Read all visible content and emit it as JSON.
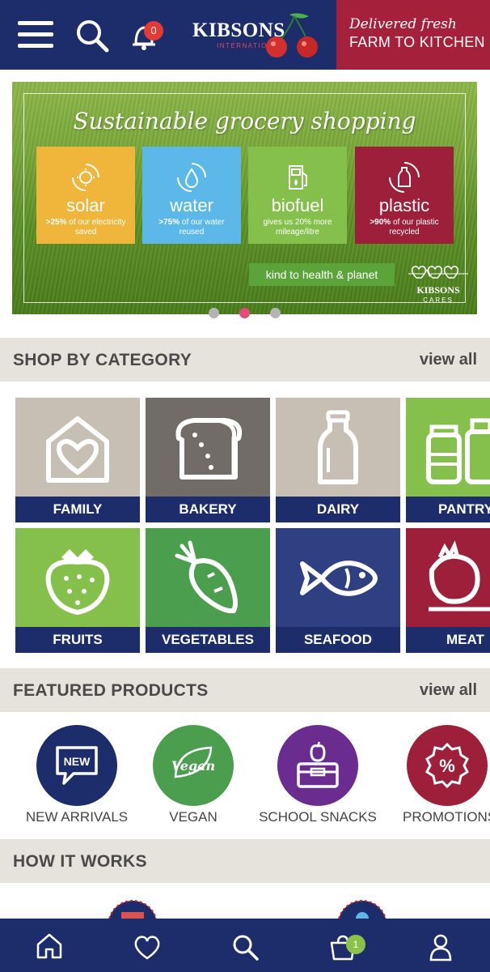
{
  "header": {
    "notification_count": "0",
    "brand_name": "KIBSONS",
    "brand_sub": "INTERNATIONAL",
    "tagline_line1": "Delivered fresh",
    "tagline_line2": "FARM TO KITCHEN",
    "colors": {
      "navy": "#1d2d6b",
      "crimson": "#a5203a"
    }
  },
  "banner": {
    "title": "Sustainable grocery shopping",
    "tiles": [
      {
        "name": "solar",
        "desc_bold": ">25%",
        "desc": "of our electricity saved",
        "icon": "sun-recycle-icon",
        "color": "#f0b63b"
      },
      {
        "name": "water",
        "desc_bold": ">75%",
        "desc": "of our water reused",
        "icon": "water-drop-recycle-icon",
        "color": "#5bb8e8"
      },
      {
        "name": "biofuel",
        "desc_bold": "20%",
        "desc": "gives us 20% more mileage/litre",
        "icon": "fuel-pump-icon",
        "color": "#86c04c"
      },
      {
        "name": "plastic",
        "desc_bold": ">90%",
        "desc": "of our plastic recycled",
        "icon": "bottle-recycle-icon",
        "color": "#9e1f3a"
      }
    ],
    "button_label": "kind to health & planet",
    "cares_brand": "KIBSONS",
    "cares_text": "CARES",
    "carousel_pages": 3,
    "carousel_active": 2
  },
  "categories": {
    "title": "SHOP BY CATEGORY",
    "view_all": "view all",
    "items": [
      {
        "label": "FAMILY",
        "icon": "house-heart-icon",
        "color": "#c7bfb4"
      },
      {
        "label": "BAKERY",
        "icon": "bread-icon",
        "color": "#716c67"
      },
      {
        "label": "DAIRY",
        "icon": "milk-bottle-icon",
        "color": "#c7bfb4"
      },
      {
        "label": "PANTRY",
        "icon": "jars-icon",
        "color": "#86c04c"
      },
      {
        "label": "FRUITS",
        "icon": "strawberry-icon",
        "color": "#86c04c"
      },
      {
        "label": "VEGETABLES",
        "icon": "carrot-icon",
        "color": "#4a9e4e"
      },
      {
        "label": "SEAFOOD",
        "icon": "fish-icon",
        "color": "#2e3f82"
      },
      {
        "label": "MEAT",
        "icon": "chicken-icon",
        "color": "#9e1f3a"
      }
    ]
  },
  "featured": {
    "title": "FEATURED PRODUCTS",
    "view_all": "view all",
    "items": [
      {
        "label": "NEW ARRIVALS",
        "icon": "new-speech-bubble-icon",
        "color": "#1d2d6b"
      },
      {
        "label": "VEGAN",
        "icon": "vegan-leaf-icon",
        "color": "#4a9e4e"
      },
      {
        "label": "SCHOOL SNACKS",
        "icon": "lunchbox-apple-icon",
        "color": "#6a2d8f"
      },
      {
        "label": "PROMOTIONS",
        "icon": "percent-badge-icon",
        "color": "#9e1f3a"
      }
    ]
  },
  "how_it_works": {
    "title": "HOW IT WORKS"
  },
  "bottom_nav": {
    "items": [
      "home-icon",
      "heart-icon",
      "search-icon",
      "cart-icon",
      "user-icon"
    ],
    "cart_count": "1"
  }
}
